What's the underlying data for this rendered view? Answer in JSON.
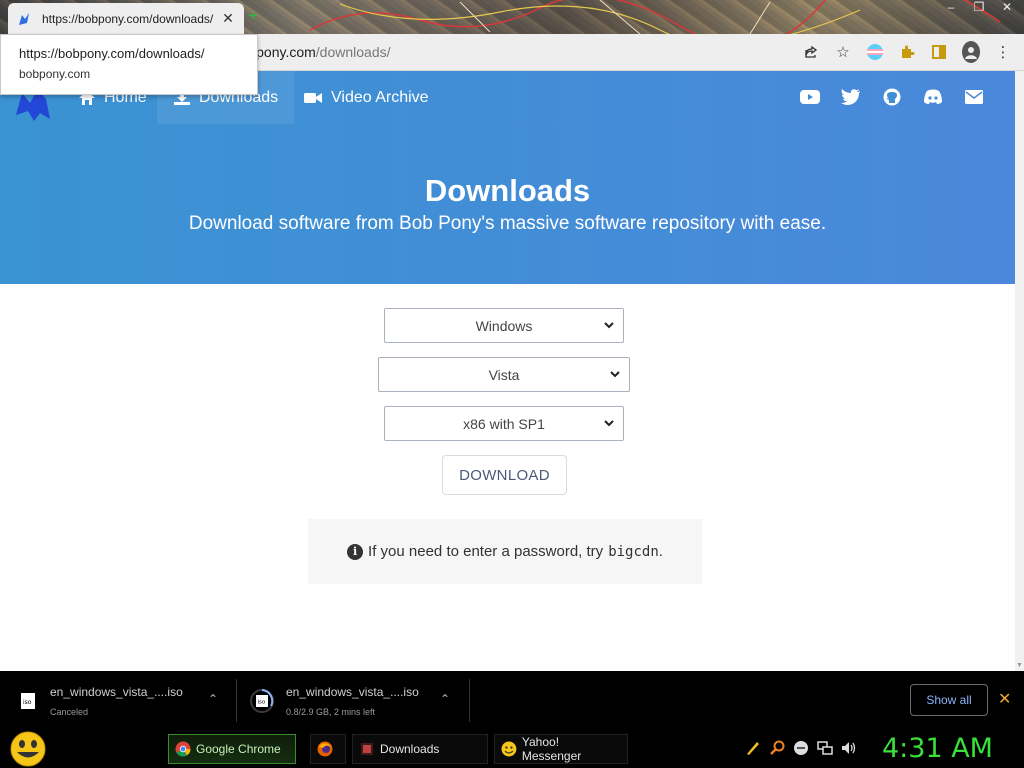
{
  "browser": {
    "tab_title": "https://bobpony.com/downloads/",
    "new_tab_symbol": "+",
    "omnibox": {
      "scheme_fragment": "//",
      "host": "bobpony.com",
      "path": "/downloads/"
    },
    "tooltip": {
      "url": "https://bobpony.com/downloads/",
      "domain": "bobpony.com"
    },
    "toolbar_icons": [
      "share-icon",
      "bookmark-star-icon",
      "profile-flag-icon",
      "extensions-puzzle-icon",
      "sidepanel-icon",
      "account-avatar-icon",
      "menu-dots-icon"
    ]
  },
  "site": {
    "nav": [
      {
        "label": "Home",
        "icon": "home-icon"
      },
      {
        "label": "Downloads",
        "icon": "download-icon"
      },
      {
        "label": "Video Archive",
        "icon": "video-camera-icon"
      }
    ],
    "social_icons": [
      "youtube-icon",
      "twitter-icon",
      "github-icon",
      "discord-icon",
      "email-icon"
    ],
    "hero": {
      "title": "Downloads",
      "subtitle": "Download software from Bob Pony's massive software repository with ease."
    },
    "selects": {
      "os": "Windows",
      "version": "Vista",
      "edition": "x86 with SP1"
    },
    "download_button": "DOWNLOAD",
    "note": {
      "text": "If you need to enter a password, try",
      "code": "bigcdn",
      "end": "."
    }
  },
  "downloads_shelf": {
    "items": [
      {
        "name": "en_windows_vista_....iso",
        "status": "Canceled"
      },
      {
        "name": "en_windows_vista_....iso",
        "status": "0.8/2.9 GB, 2 mins left"
      }
    ],
    "show_all": "Show all"
  },
  "taskbar": {
    "buttons": [
      {
        "label": "Google Chrome",
        "icon": "chrome-icon",
        "active": true
      },
      {
        "label": "",
        "icon": "firefox-icon",
        "active": false
      },
      {
        "label": "Downloads",
        "icon": "folder-icon",
        "active": false
      },
      {
        "label": "Yahoo! Messenger",
        "icon": "yahoo-messenger-icon",
        "active": false
      }
    ],
    "clock": "4:31 AM"
  },
  "colors": {
    "hero_start": "#3a93d2",
    "hero_end": "#4b88db",
    "clock_green": "#3ae03a",
    "show_all_blue": "#8ab4f8"
  }
}
